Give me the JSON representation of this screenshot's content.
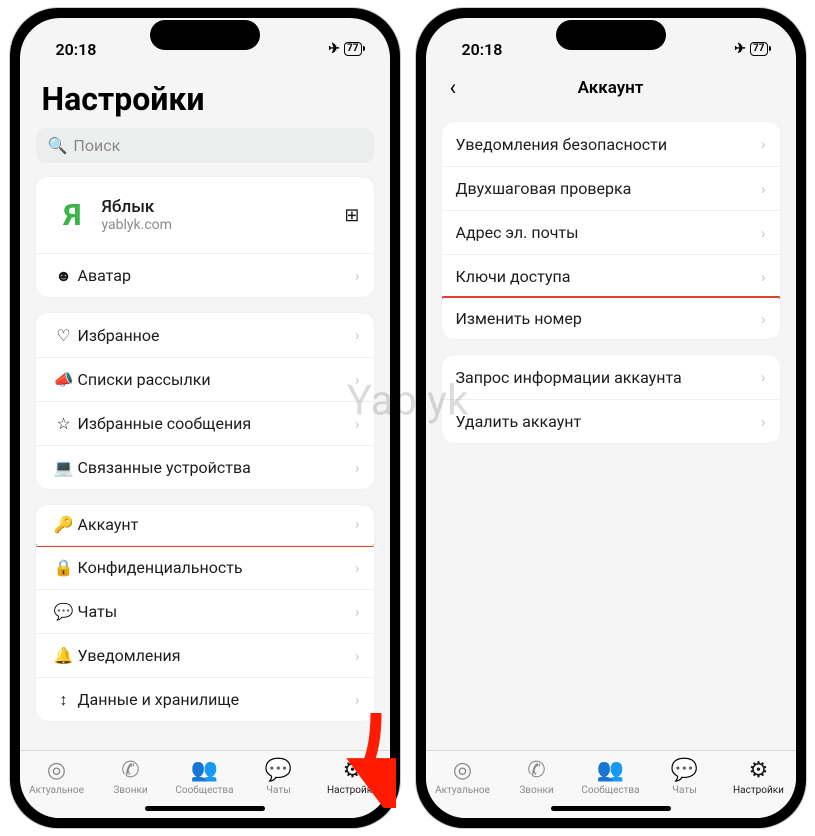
{
  "watermark": "Yablyk",
  "status": {
    "time": "20:18",
    "battery": "77"
  },
  "phone1": {
    "title": "Настройки",
    "search_placeholder": "Поиск",
    "profile": {
      "name": "Яблык",
      "sub": "yablyk.com",
      "avatar_letter": "Я"
    },
    "avatar_row": "Аватар",
    "group1": [
      {
        "label": "Избранное",
        "icon": "♡"
      },
      {
        "label": "Списки рассылки",
        "icon": "📣"
      },
      {
        "label": "Избранные сообщения",
        "icon": "☆"
      },
      {
        "label": "Связанные устройства",
        "icon": "💻"
      }
    ],
    "group2": [
      {
        "label": "Аккаунт",
        "icon": "🔑",
        "highlight": true
      },
      {
        "label": "Конфиденциальность",
        "icon": "🔒"
      },
      {
        "label": "Чаты",
        "icon": "💬"
      },
      {
        "label": "Уведомления",
        "icon": "🔔"
      },
      {
        "label": "Данные и хранилище",
        "icon": "↕"
      }
    ]
  },
  "phone2": {
    "header": "Аккаунт",
    "group1": [
      {
        "label": "Уведомления безопасности"
      },
      {
        "label": "Двухшаговая проверка"
      },
      {
        "label": "Адрес эл. почты"
      },
      {
        "label": "Ключи доступа"
      },
      {
        "label": "Изменить номер",
        "highlight": true
      }
    ],
    "group2": [
      {
        "label": "Запрос информации аккаунта"
      },
      {
        "label": "Удалить аккаунт"
      }
    ]
  },
  "tabs": [
    {
      "label": "Актуальное",
      "icon": "◎"
    },
    {
      "label": "Звонки",
      "icon": "✆"
    },
    {
      "label": "Сообщества",
      "icon": "👥"
    },
    {
      "label": "Чаты",
      "icon": "💬"
    },
    {
      "label": "Настройки",
      "icon": "⚙"
    }
  ]
}
